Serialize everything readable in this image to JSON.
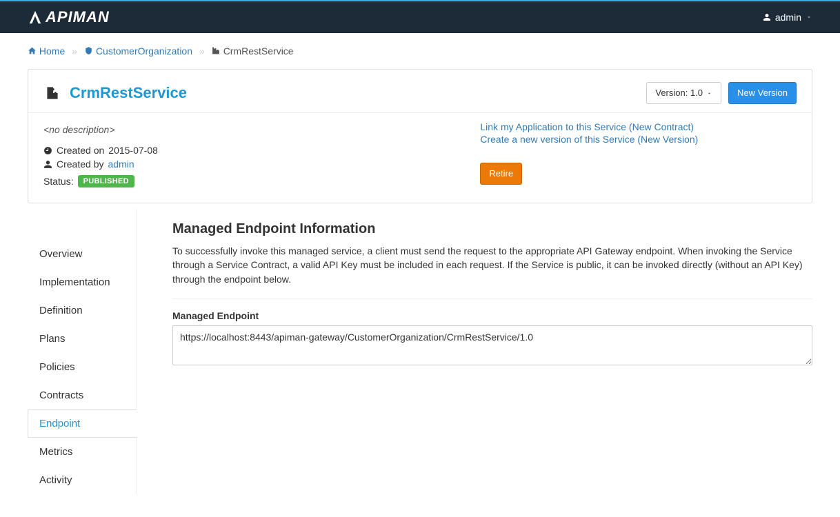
{
  "header": {
    "logo_text": "APIMAN",
    "user_name": "admin"
  },
  "breadcrumb": {
    "home": "Home",
    "org": "CustomerOrganization",
    "current": "CrmRestService"
  },
  "service": {
    "name": "CrmRestService",
    "description": "<no description>",
    "created_on_label": "Created on",
    "created_on": "2015-07-08",
    "created_by_label": "Created by",
    "created_by": "admin",
    "status_label": "Status:",
    "status_badge": "PUBLISHED",
    "version_label": "Version: 1.0",
    "new_version_btn": "New Version",
    "link_app": "Link my Application to this Service (New Contract)",
    "create_version": "Create a new version of this Service (New Version)",
    "retire_btn": "Retire"
  },
  "tabs": {
    "overview": "Overview",
    "implementation": "Implementation",
    "definition": "Definition",
    "plans": "Plans",
    "policies": "Policies",
    "contracts": "Contracts",
    "endpoint": "Endpoint",
    "metrics": "Metrics",
    "activity": "Activity"
  },
  "endpoint_page": {
    "title": "Managed Endpoint Information",
    "description": "To successfully invoke this managed service, a client must send the request to the appropriate API Gateway endpoint. When invoking the Service through a Service Contract, a valid API Key must be included in each request. If the Service is public, it can be invoked directly (without an API Key) through the endpoint below.",
    "field_label": "Managed Endpoint",
    "endpoint_url": "https://localhost:8443/apiman-gateway/CustomerOrganization/CrmRestService/1.0"
  }
}
